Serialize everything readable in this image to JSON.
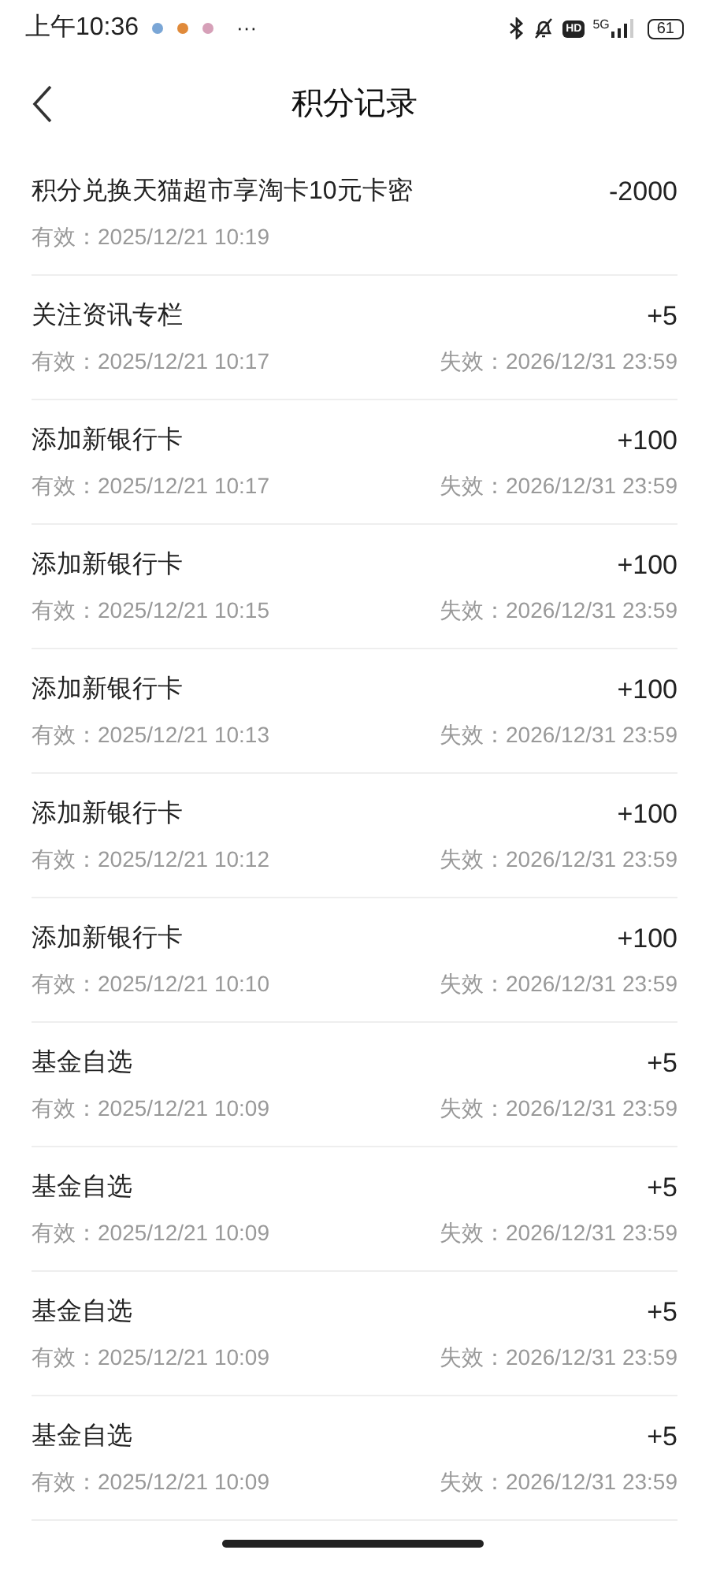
{
  "status_bar": {
    "time": "上午10:36",
    "more": "···",
    "hd": "HD",
    "network": "5G",
    "battery": "61"
  },
  "header": {
    "title": "积分记录"
  },
  "records": [
    {
      "title": "积分兑换天猫超市享淘卡10元卡密",
      "points": "-2000",
      "valid": "有效：2025/12/21 10:19"
    },
    {
      "title": "关注资讯专栏",
      "points": "+5",
      "valid": "有效：2025/12/21 10:17",
      "expires": "失效：2026/12/31 23:59"
    },
    {
      "title": "添加新银行卡",
      "points": "+100",
      "valid": "有效：2025/12/21 10:17",
      "expires": "失效：2026/12/31 23:59"
    },
    {
      "title": "添加新银行卡",
      "points": "+100",
      "valid": "有效：2025/12/21 10:15",
      "expires": "失效：2026/12/31 23:59"
    },
    {
      "title": "添加新银行卡",
      "points": "+100",
      "valid": "有效：2025/12/21 10:13",
      "expires": "失效：2026/12/31 23:59"
    },
    {
      "title": "添加新银行卡",
      "points": "+100",
      "valid": "有效：2025/12/21 10:12",
      "expires": "失效：2026/12/31 23:59"
    },
    {
      "title": "添加新银行卡",
      "points": "+100",
      "valid": "有效：2025/12/21 10:10",
      "expires": "失效：2026/12/31 23:59"
    },
    {
      "title": "基金自选",
      "points": "+5",
      "valid": "有效：2025/12/21 10:09",
      "expires": "失效：2026/12/31 23:59"
    },
    {
      "title": "基金自选",
      "points": "+5",
      "valid": "有效：2025/12/21 10:09",
      "expires": "失效：2026/12/31 23:59"
    },
    {
      "title": "基金自选",
      "points": "+5",
      "valid": "有效：2025/12/21 10:09",
      "expires": "失效：2026/12/31 23:59"
    },
    {
      "title": "基金自选",
      "points": "+5",
      "valid": "有效：2025/12/21 10:09",
      "expires": "失效：2026/12/31 23:59"
    }
  ]
}
